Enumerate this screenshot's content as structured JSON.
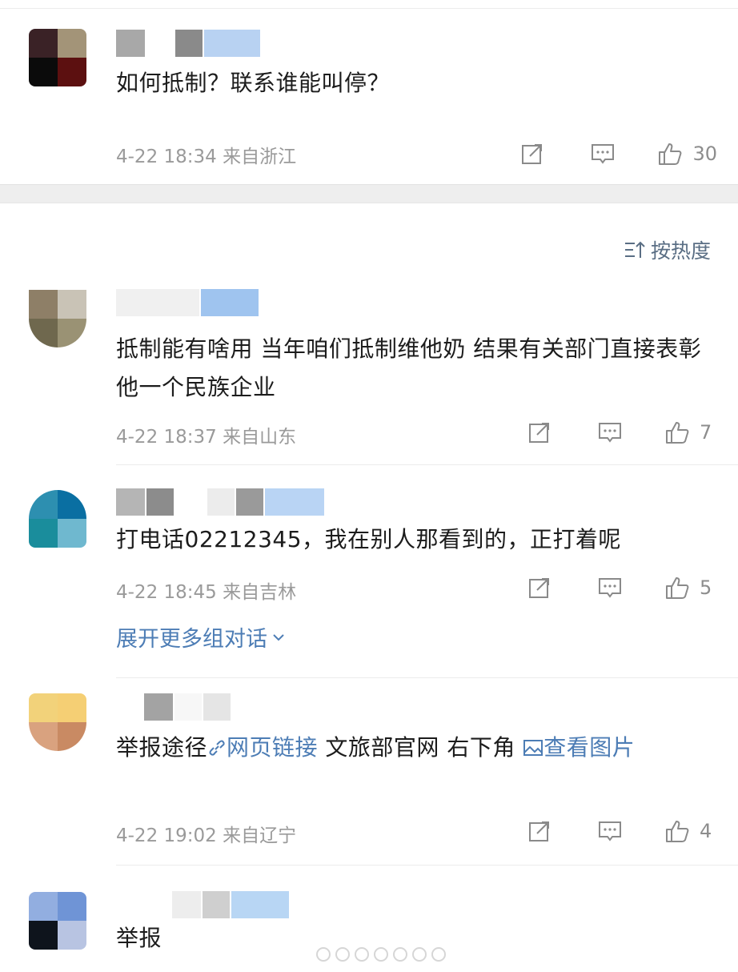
{
  "sort": {
    "label": "按热度"
  },
  "comments": [
    {
      "text": "如何抵制？联系谁能叫停？",
      "time": "4-22 18:34",
      "location": "来自浙江",
      "likes": "30",
      "avatar_colors": [
        "#3a2226",
        "#a39478",
        "#0b0b0b",
        "#5c1010"
      ],
      "name_blur": [
        "#a8a8a8",
        "#ffffff",
        "#8a8a8a",
        "#b8d2f2"
      ]
    },
    {
      "text": "抵制能有啥用 当年咱们抵制维他奶 结果有关部门直接表彰他一个民族企业",
      "time": "4-22 18:37",
      "location": "来自山东",
      "likes": "7",
      "avatar_colors": [
        "#8e7f67",
        "#c9c3b6",
        "#6f684e",
        "#9a9274"
      ],
      "name_blur": [
        "#f0f0f0",
        "#9fc4ef"
      ]
    },
    {
      "text": "打电话02212345，我在别人那看到的，正打着呢",
      "time": "4-22 18:45",
      "location": "来自吉林",
      "likes": "5",
      "avatar_colors": [
        "#2d8fb0",
        "#0a6fa2",
        "#1a8d9c",
        "#6fb8cf"
      ],
      "name_blur": [
        "#b5b5b5",
        "#8c8c8c",
        "#ececec",
        "#9a9a9a",
        "#b9d4f4"
      ]
    },
    {
      "text_parts": {
        "prefix": "举报途径",
        "link1": "网页链接",
        "middle": " 文旅部官网 右下角 ",
        "link2": "查看图片"
      },
      "time": "4-22 19:02",
      "location": "来自辽宁",
      "likes": "4",
      "avatar_colors": [
        "#f2d27a",
        "#f5cf74",
        "#d9a27f",
        "#c98a63"
      ],
      "name_blur": [
        "#a3a3a3",
        "#f7f7f7",
        "#e5e5e5"
      ]
    },
    {
      "text": "举报",
      "avatar_colors": [
        "#92aee0",
        "#6f94d6",
        "#0e141c",
        "#b8c4e2"
      ],
      "name_blur": [
        "#ededed",
        "#cfcfcf",
        "#b8d6f4"
      ]
    }
  ],
  "expand": {
    "label": "展开更多组对话"
  },
  "icons": {
    "repost": "repost-icon",
    "comment": "comment-icon",
    "like": "thumbs-up-icon",
    "sort": "sort-icon",
    "link": "link-icon",
    "image": "image-icon",
    "chevron": "chevron-down-icon"
  },
  "colors": {
    "link": "#4d7db5",
    "meta": "#9a9a9a",
    "text": "#1c1c1c"
  }
}
